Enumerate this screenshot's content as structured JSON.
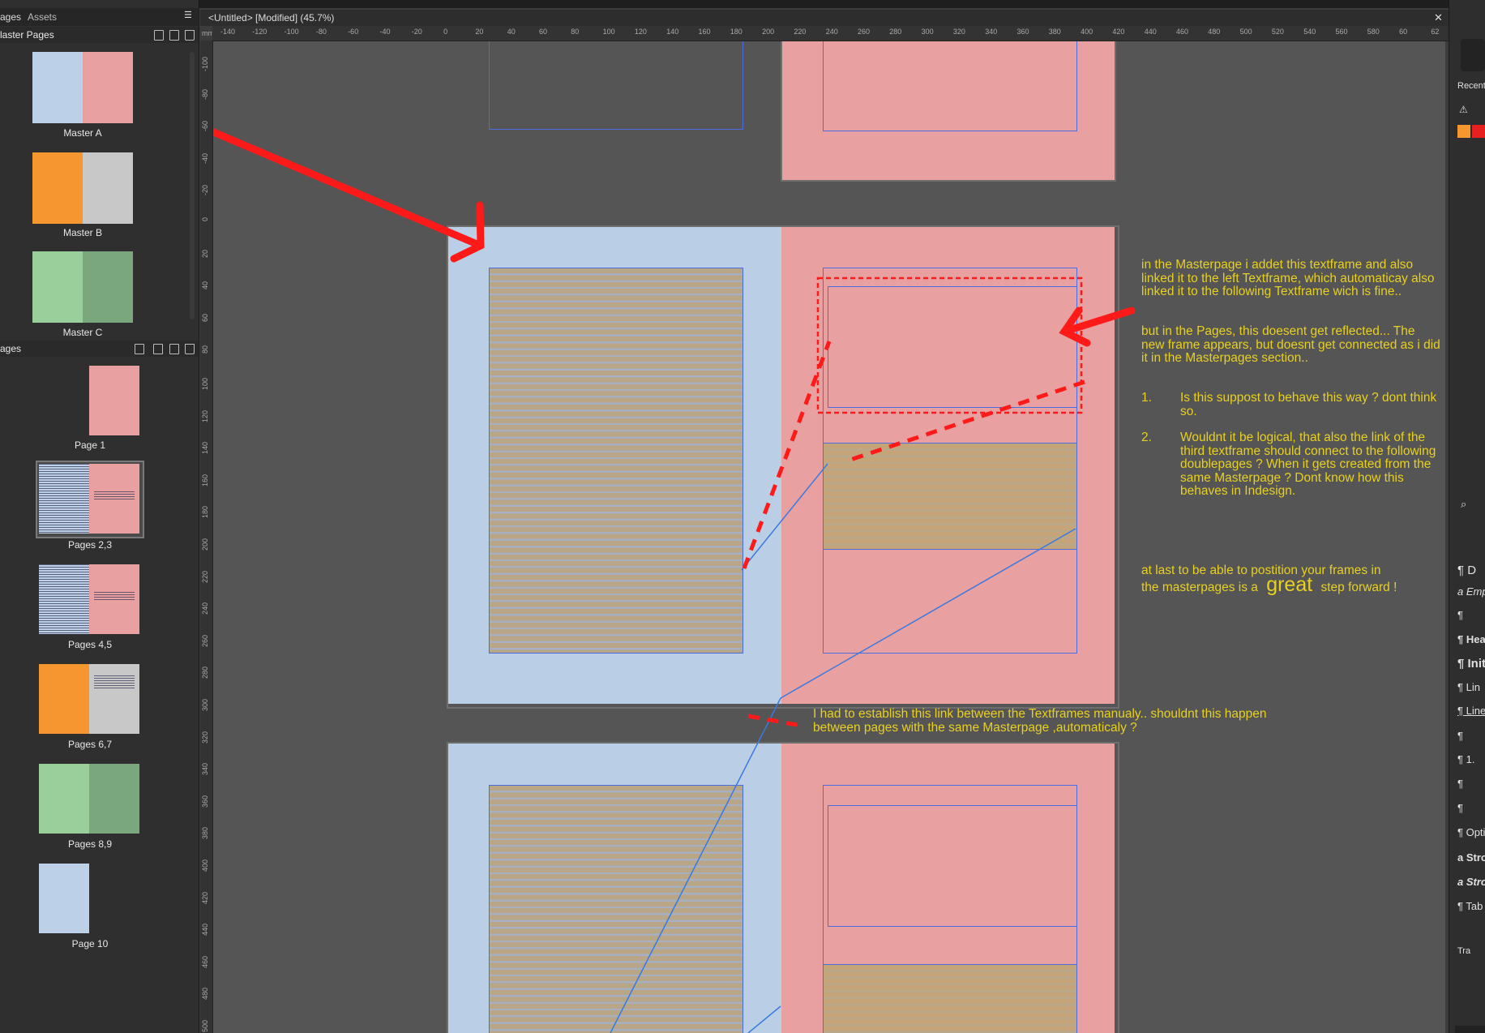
{
  "left_panel": {
    "tabs": [
      "ages",
      "Assets"
    ],
    "master_section_label": "laster Pages",
    "masters": [
      {
        "label": "Master A",
        "left_color": "#bcd0e8",
        "right_color": "#e8a0a0"
      },
      {
        "label": "Master B",
        "left_color": "#f5962f",
        "right_color": "#c8c8c8"
      },
      {
        "label": "Master C",
        "left_color": "#98cf9b",
        "right_color": "#7aa77c"
      }
    ],
    "pages_section_label": "ages",
    "pages": [
      {
        "label": "Page 1"
      },
      {
        "label": "Pages 2,3"
      },
      {
        "label": "Pages 4,5"
      },
      {
        "label": "Pages 6,7"
      },
      {
        "label": "Pages 8,9"
      },
      {
        "label": "Page 10"
      }
    ]
  },
  "document": {
    "tab_title": "<Untitled> [Modified] (45.7%)",
    "ruler_unit": "mm",
    "ruler_h_labels": [
      "-140",
      "-120",
      "-100",
      "-80",
      "-60",
      "-40",
      "-20",
      "0",
      "20",
      "40",
      "60",
      "80",
      "100",
      "120",
      "140",
      "160",
      "180",
      "200",
      "220",
      "240",
      "260",
      "280",
      "300",
      "320",
      "340",
      "360",
      "380",
      "400",
      "420",
      "440",
      "460",
      "480",
      "500",
      "520",
      "540",
      "560",
      "580",
      "60",
      "62"
    ],
    "ruler_v_labels": [
      "-100",
      "-80",
      "-60",
      "-40",
      "-20",
      "0",
      "20",
      "40",
      "60",
      "80",
      "100",
      "120",
      "140",
      "160",
      "180",
      "200",
      "220",
      "240",
      "260",
      "280",
      "300",
      "320",
      "340",
      "360",
      "380",
      "400",
      "420",
      "440",
      "460",
      "480",
      "500"
    ]
  },
  "annotations": {
    "note1": "in the Masterpage i addet this textframe and also linked it to the left Textframe, which automaticay also linked it to the following Textframe  wich is fine..",
    "note2": "but in the Pages, this doesent get reflected... The new frame appears, but doesnt get connected as i did it in the Masterpages section..",
    "q1_num": "1.",
    "q1": "Is this suppost to behave this way ?  dont think so.",
    "q2_num": "2.",
    "q2": "Wouldnt it be logical, that also the link of the third textframe should connect to the following doublepages ? When it gets created from the same Masterpage ? Dont know how this behaves in Indesign.",
    "final_pre": "at last to be able to postition your frames in the masterpages is a",
    "final_big": "great",
    "final_post": "step forward !",
    "bottom_note": "I had to establish this link between the Textframes manualy..  shouldnt this happen between pages with the same Masterpage ,automaticaly ?"
  },
  "right_panel": {
    "recent_label": "Recent",
    "style_items": [
      "¶ D",
      "a Emp",
      "¶",
      "¶ Hea",
      "¶ Init",
      "¶ Lin",
      "¶ Line",
      "¶",
      "¶ 1.",
      "¶",
      "¶",
      "¶ Opti",
      "a Stro",
      "a Stro",
      "¶ Tab",
      "Tra"
    ]
  },
  "colors": {
    "arrow_red": "#ff1a1a",
    "note_yellow": "#e8d020",
    "frame_blue": "#4a6ee0",
    "page_blue": "#bacfe6",
    "page_pink": "#e8a0a0"
  }
}
